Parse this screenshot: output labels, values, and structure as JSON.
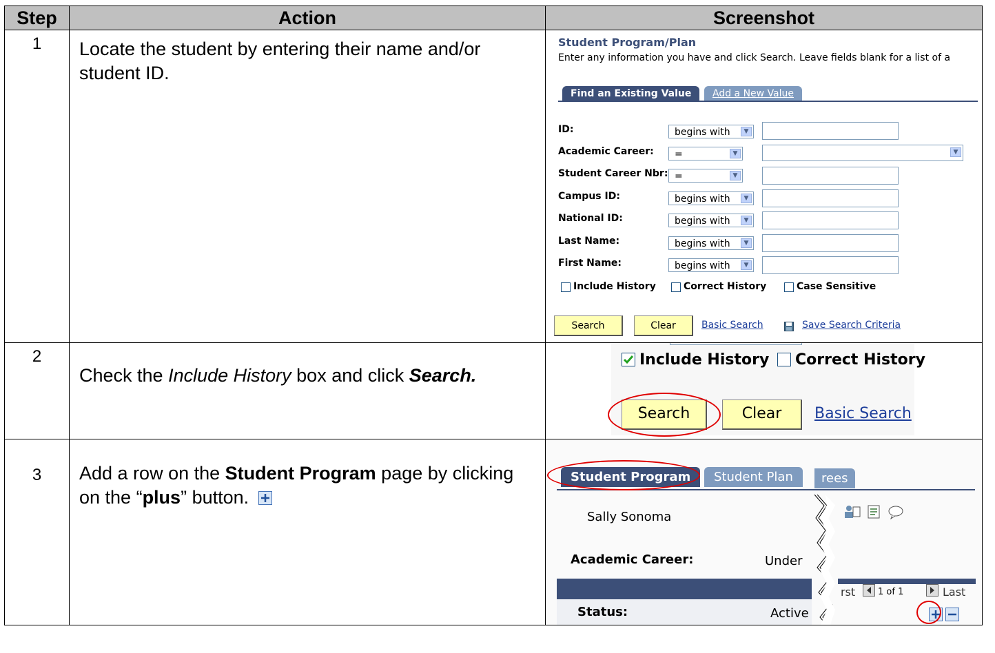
{
  "headers": {
    "step": "Step",
    "action": "Action",
    "screenshot": "Screenshot"
  },
  "rows": [
    {
      "step": "1",
      "action": "Locate the student by entering their name and/or student ID."
    },
    {
      "step": "2",
      "action_pre": "Check the ",
      "action_em": "Include History",
      "action_mid": " box and click ",
      "action_strong": "Search."
    },
    {
      "step": "3",
      "action_pre": "Add a row on the ",
      "action_strong": "Student Program",
      "action_mid": " page by clicking on the “",
      "action_strong2": "plus",
      "action_post": "” button."
    }
  ],
  "shot1": {
    "title": "Student Program/Plan",
    "instructions": "Enter any information you have and click Search. Leave fields blank for a list of a",
    "tab_active": "Find an Existing Value",
    "tab_inactive": "Add a New Value",
    "fields": [
      {
        "label": "ID:",
        "operator": "begins with"
      },
      {
        "label": "Academic Career:",
        "operator": "="
      },
      {
        "label": "Student Career Nbr:",
        "operator": "="
      },
      {
        "label": "Campus ID:",
        "operator": "begins with"
      },
      {
        "label": "National ID:",
        "operator": "begins with"
      },
      {
        "label": "Last Name:",
        "operator": "begins with"
      },
      {
        "label": "First Name:",
        "operator": "begins with"
      }
    ],
    "checkboxes": [
      "Include History",
      "Correct History",
      "Case Sensitive"
    ],
    "search_button": "Search",
    "clear_button": "Clear",
    "basic_search": "Basic Search",
    "save_search": "Save Search Criteria"
  },
  "shot2": {
    "include_history": "Include History",
    "correct_history": "Correct History",
    "search_button": "Search",
    "clear_button": "Clear",
    "basic_search": "Basic Search"
  },
  "shot3": {
    "tab_active": "Student Program",
    "tab_inactive": "Student Plan",
    "tab_partial": "rees",
    "name": "Sally Sonoma",
    "career_label": "Academic Career:",
    "career_value": "Under",
    "nav_first": "rst",
    "nav_count": "1 of 1",
    "nav_last": "Last",
    "status_label": "Status:",
    "status_value": "Active"
  },
  "colors": {
    "header_bg": "#c0c0c0",
    "tab_active": "#3c4f78",
    "tab_inactive": "#7f9bbf",
    "button_bg": "#ffffb4",
    "link": "#1d3e9b",
    "highlight": "#e00000"
  }
}
